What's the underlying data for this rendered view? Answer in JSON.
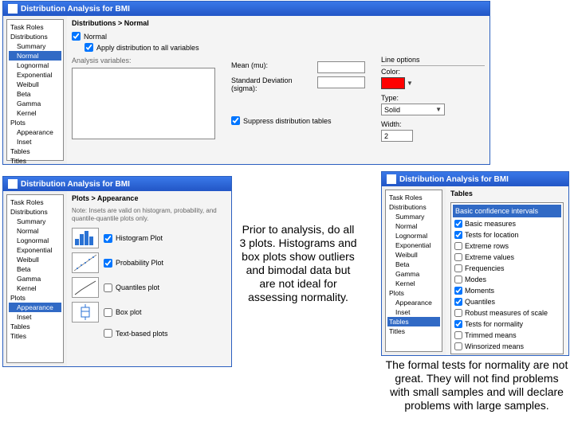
{
  "win_normal": {
    "title": "Distribution Analysis for BMI",
    "breadcrumb": "Distributions > Normal",
    "tree": [
      "Task Roles",
      "Distributions",
      "Summary",
      "Normal",
      "Lognormal",
      "Exponential",
      "Weibull",
      "Beta",
      "Gamma",
      "Kernel",
      "Plots",
      "Appearance",
      "Inset",
      "Tables",
      "Titles"
    ],
    "tree_indent": [
      false,
      false,
      true,
      true,
      true,
      true,
      true,
      true,
      true,
      true,
      false,
      true,
      true,
      false,
      false
    ],
    "tree_selected": 3,
    "chk_normal": "Normal",
    "chk_apply": "Apply distribution to all variables",
    "analysis_label": "Analysis variables:",
    "mean_label": "Mean (mu):",
    "sd_label": "Standard Deviation (sigma):",
    "chk_suppress": "Suppress distribution tables",
    "line_title": "Line options",
    "color_label": "Color:",
    "color_value": "#ff0000",
    "type_label": "Type:",
    "type_value": "Solid",
    "width_label": "Width:",
    "width_value": "2"
  },
  "win_appearance": {
    "title": "Distribution Analysis for BMI",
    "breadcrumb": "Plots > Appearance",
    "tree": [
      "Task Roles",
      "Distributions",
      "Summary",
      "Normal",
      "Lognormal",
      "Exponential",
      "Weibull",
      "Beta",
      "Gamma",
      "Kernel",
      "Plots",
      "Appearance",
      "Inset",
      "Tables",
      "Titles"
    ],
    "tree_indent": [
      false,
      false,
      true,
      true,
      true,
      true,
      true,
      true,
      true,
      true,
      false,
      true,
      true,
      false,
      false
    ],
    "tree_selected": 11,
    "note": "Note: Insets are valid on histogram, probability, and quantile-quantile plots only.",
    "rows": [
      {
        "label": "Histogram Plot",
        "checked": true,
        "kind": "hist"
      },
      {
        "label": "Probability Plot",
        "checked": true,
        "kind": "prob"
      },
      {
        "label": "Quantiles plot",
        "checked": false,
        "kind": "qq"
      },
      {
        "label": "Box plot",
        "checked": false,
        "kind": "box"
      },
      {
        "label": "Text-based plots",
        "checked": false,
        "kind": "none"
      }
    ]
  },
  "win_tables": {
    "title": "Distribution Analysis for BMI",
    "breadcrumb": "Tables",
    "tree": [
      "Task Roles",
      "Distributions",
      "Summary",
      "Normal",
      "Lognormal",
      "Exponential",
      "Weibull",
      "Beta",
      "Gamma",
      "Kernel",
      "Plots",
      "Appearance",
      "Inset",
      "Tables",
      "Titles"
    ],
    "tree_indent": [
      false,
      false,
      true,
      true,
      true,
      true,
      true,
      true,
      true,
      true,
      false,
      true,
      true,
      false,
      false
    ],
    "tree_selected": 13,
    "list_header": "Basic confidence intervals",
    "items": [
      {
        "label": "Basic measures",
        "checked": true
      },
      {
        "label": "Tests for location",
        "checked": true
      },
      {
        "label": "Extreme rows",
        "checked": false
      },
      {
        "label": "Extreme values",
        "checked": false
      },
      {
        "label": "Frequencies",
        "checked": false
      },
      {
        "label": "Modes",
        "checked": false
      },
      {
        "label": "Moments",
        "checked": true
      },
      {
        "label": "Quantiles",
        "checked": true
      },
      {
        "label": "Robust measures of scale",
        "checked": false
      },
      {
        "label": "Tests for normality",
        "checked": true
      },
      {
        "label": "Trimmed means",
        "checked": false
      },
      {
        "label": "Winsorized means",
        "checked": false
      }
    ]
  },
  "anno1": "Prior to analysis, do all 3 plots. Histograms and box plots show outliers and bimodal data but are not ideal for assessing normality.",
  "anno2": "The formal tests for normality are not great.  They will not find problems with small samples and will declare problems with large samples."
}
